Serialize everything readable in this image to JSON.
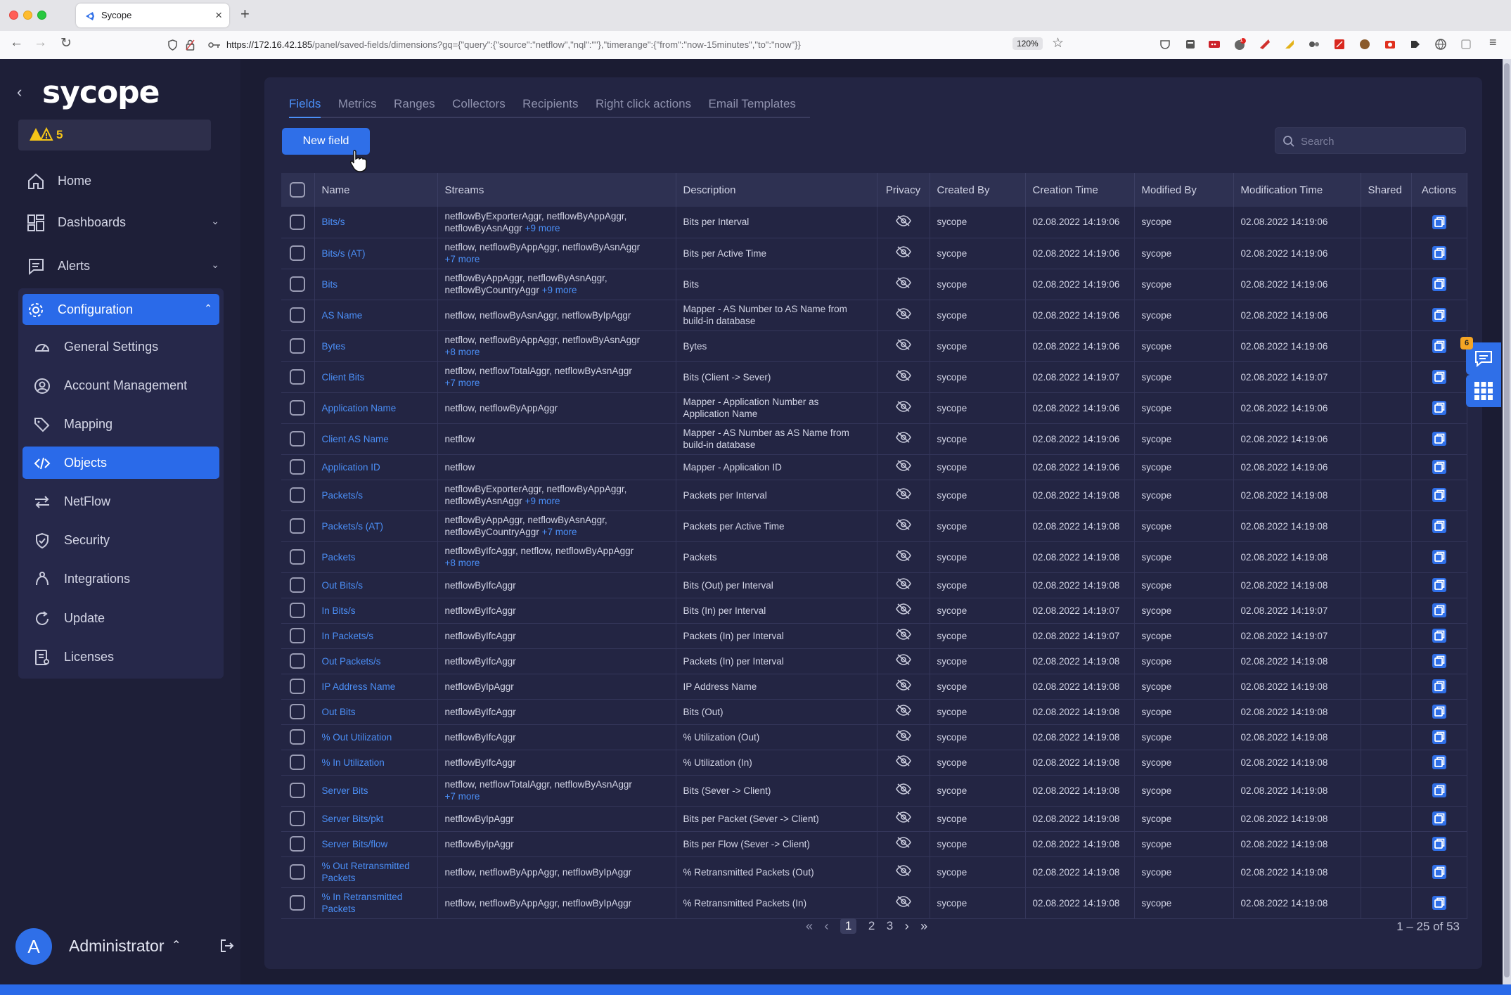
{
  "browser": {
    "tab_title": "Sycope",
    "url_host": "https://172.16.42.185",
    "url_path": "/panel/saved-fields/dimensions?gq={\"query\":{\"source\":\"netflow\",\"nql\":\"\"},\"timerange\":{\"from\":\"now-15minutes\",\"to\":\"now\"}}",
    "zoom": "120%",
    "ext_badge": "1"
  },
  "sidebar": {
    "logo": "sycope",
    "alert_count": "5",
    "nav": {
      "home": "Home",
      "dashboards": "Dashboards",
      "alerts": "Alerts",
      "configuration": "Configuration"
    },
    "sub": {
      "general": "General Settings",
      "account": "Account Management",
      "mapping": "Mapping",
      "objects": "Objects",
      "netflow": "NetFlow",
      "security": "Security",
      "integrations": "Integrations",
      "update": "Update",
      "licenses": "Licenses"
    },
    "user": {
      "initial": "A",
      "name": "Administrator"
    }
  },
  "main": {
    "tabs": [
      "Fields",
      "Metrics",
      "Ranges",
      "Collectors",
      "Recipients",
      "Right click actions",
      "Email Templates"
    ],
    "new_field_label": "New field",
    "search_placeholder": "Search",
    "columns": [
      "Name",
      "Streams",
      "Description",
      "Privacy",
      "Created By",
      "Creation Time",
      "Modified By",
      "Modification Time",
      "Shared",
      "Actions"
    ],
    "rows": [
      {
        "name": "Bits/s",
        "streams": "netflowByExporterAggr, netflowByAppAggr,",
        "streams2": "netflowByAsnAggr",
        "more": "+9 more",
        "desc": "Bits per Interval",
        "desc2": "",
        "created_by": "sycope",
        "created": "02.08.2022 14:19:06",
        "modified_by": "sycope",
        "modified": "02.08.2022 14:19:06"
      },
      {
        "name": "Bits/s (AT)",
        "streams": "netflow, netflowByAppAggr, netflowByAsnAggr",
        "streams2": "",
        "more": "+7 more",
        "desc": "Bits per Active Time",
        "desc2": "",
        "created_by": "sycope",
        "created": "02.08.2022 14:19:06",
        "modified_by": "sycope",
        "modified": "02.08.2022 14:19:06"
      },
      {
        "name": "Bits",
        "streams": "netflowByAppAggr, netflowByAsnAggr,",
        "streams2": "netflowByCountryAggr",
        "more": "+9 more",
        "desc": "Bits",
        "desc2": "",
        "created_by": "sycope",
        "created": "02.08.2022 14:19:06",
        "modified_by": "sycope",
        "modified": "02.08.2022 14:19:06"
      },
      {
        "name": "AS Name",
        "streams": "netflow, netflowByAsnAggr, netflowByIpAggr",
        "streams2": "",
        "more": "",
        "desc": "Mapper - AS Number to AS Name from",
        "desc2": "build-in database",
        "created_by": "sycope",
        "created": "02.08.2022 14:19:06",
        "modified_by": "sycope",
        "modified": "02.08.2022 14:19:06"
      },
      {
        "name": "Bytes",
        "streams": "netflow, netflowByAppAggr, netflowByAsnAggr",
        "streams2": "",
        "more": "+8 more",
        "desc": "Bytes",
        "desc2": "",
        "created_by": "sycope",
        "created": "02.08.2022 14:19:06",
        "modified_by": "sycope",
        "modified": "02.08.2022 14:19:06"
      },
      {
        "name": "Client Bits",
        "streams": "netflow, netflowTotalAggr, netflowByAsnAggr",
        "streams2": "",
        "more": "+7 more",
        "desc": "Bits (Client -> Sever)",
        "desc2": "",
        "created_by": "sycope",
        "created": "02.08.2022 14:19:07",
        "modified_by": "sycope",
        "modified": "02.08.2022 14:19:07"
      },
      {
        "name": "Application Name",
        "streams": "netflow, netflowByAppAggr",
        "streams2": "",
        "more": "",
        "desc": "Mapper - Application Number as",
        "desc2": "Application Name",
        "created_by": "sycope",
        "created": "02.08.2022 14:19:06",
        "modified_by": "sycope",
        "modified": "02.08.2022 14:19:06"
      },
      {
        "name": "Client AS Name",
        "streams": "netflow",
        "streams2": "",
        "more": "",
        "desc": "Mapper - AS Number as AS Name from",
        "desc2": "build-in database",
        "created_by": "sycope",
        "created": "02.08.2022 14:19:06",
        "modified_by": "sycope",
        "modified": "02.08.2022 14:19:06"
      },
      {
        "name": "Application ID",
        "streams": "netflow",
        "streams2": "",
        "more": "",
        "desc": "Mapper - Application ID",
        "desc2": "",
        "created_by": "sycope",
        "created": "02.08.2022 14:19:06",
        "modified_by": "sycope",
        "modified": "02.08.2022 14:19:06"
      },
      {
        "name": "Packets/s",
        "streams": "netflowByExporterAggr, netflowByAppAggr,",
        "streams2": "netflowByAsnAggr",
        "more": "+9 more",
        "desc": "Packets per Interval",
        "desc2": "",
        "created_by": "sycope",
        "created": "02.08.2022 14:19:08",
        "modified_by": "sycope",
        "modified": "02.08.2022 14:19:08"
      },
      {
        "name": "Packets/s (AT)",
        "streams": "netflowByAppAggr, netflowByAsnAggr,",
        "streams2": "netflowByCountryAggr",
        "more": "+7 more",
        "desc": "Packets per Active Time",
        "desc2": "",
        "created_by": "sycope",
        "created": "02.08.2022 14:19:08",
        "modified_by": "sycope",
        "modified": "02.08.2022 14:19:08"
      },
      {
        "name": "Packets",
        "streams": "netflowByIfcAggr, netflow, netflowByAppAggr",
        "streams2": "",
        "more": "+8 more",
        "desc": "Packets",
        "desc2": "",
        "created_by": "sycope",
        "created": "02.08.2022 14:19:08",
        "modified_by": "sycope",
        "modified": "02.08.2022 14:19:08"
      },
      {
        "name": "Out Bits/s",
        "streams": "netflowByIfcAggr",
        "streams2": "",
        "more": "",
        "desc": "Bits (Out) per Interval",
        "desc2": "",
        "created_by": "sycope",
        "created": "02.08.2022 14:19:08",
        "modified_by": "sycope",
        "modified": "02.08.2022 14:19:08"
      },
      {
        "name": "In Bits/s",
        "streams": "netflowByIfcAggr",
        "streams2": "",
        "more": "",
        "desc": "Bits (In) per Interval",
        "desc2": "",
        "created_by": "sycope",
        "created": "02.08.2022 14:19:07",
        "modified_by": "sycope",
        "modified": "02.08.2022 14:19:07"
      },
      {
        "name": "In Packets/s",
        "streams": "netflowByIfcAggr",
        "streams2": "",
        "more": "",
        "desc": "Packets (In) per Interval",
        "desc2": "",
        "created_by": "sycope",
        "created": "02.08.2022 14:19:07",
        "modified_by": "sycope",
        "modified": "02.08.2022 14:19:07"
      },
      {
        "name": "Out Packets/s",
        "streams": "netflowByIfcAggr",
        "streams2": "",
        "more": "",
        "desc": "Packets (In) per Interval",
        "desc2": "",
        "created_by": "sycope",
        "created": "02.08.2022 14:19:08",
        "modified_by": "sycope",
        "modified": "02.08.2022 14:19:08"
      },
      {
        "name": "IP Address Name",
        "streams": "netflowByIpAggr",
        "streams2": "",
        "more": "",
        "desc": "IP Address Name",
        "desc2": "",
        "created_by": "sycope",
        "created": "02.08.2022 14:19:08",
        "modified_by": "sycope",
        "modified": "02.08.2022 14:19:08"
      },
      {
        "name": "Out Bits",
        "streams": "netflowByIfcAggr",
        "streams2": "",
        "more": "",
        "desc": "Bits (Out)",
        "desc2": "",
        "created_by": "sycope",
        "created": "02.08.2022 14:19:08",
        "modified_by": "sycope",
        "modified": "02.08.2022 14:19:08"
      },
      {
        "name": "% Out Utilization",
        "streams": "netflowByIfcAggr",
        "streams2": "",
        "more": "",
        "desc": "% Utilization (Out)",
        "desc2": "",
        "created_by": "sycope",
        "created": "02.08.2022 14:19:08",
        "modified_by": "sycope",
        "modified": "02.08.2022 14:19:08"
      },
      {
        "name": "% In Utilization",
        "streams": "netflowByIfcAggr",
        "streams2": "",
        "more": "",
        "desc": "% Utilization (In)",
        "desc2": "",
        "created_by": "sycope",
        "created": "02.08.2022 14:19:08",
        "modified_by": "sycope",
        "modified": "02.08.2022 14:19:08"
      },
      {
        "name": "Server Bits",
        "streams": "netflow, netflowTotalAggr, netflowByAsnAggr",
        "streams2": "",
        "more": "+7 more",
        "desc": "Bits (Sever -> Client)",
        "desc2": "",
        "created_by": "sycope",
        "created": "02.08.2022 14:19:08",
        "modified_by": "sycope",
        "modified": "02.08.2022 14:19:08"
      },
      {
        "name": "Server Bits/pkt",
        "streams": "netflowByIpAggr",
        "streams2": "",
        "more": "",
        "desc": "Bits per Packet (Sever -> Client)",
        "desc2": "",
        "created_by": "sycope",
        "created": "02.08.2022 14:19:08",
        "modified_by": "sycope",
        "modified": "02.08.2022 14:19:08"
      },
      {
        "name": "Server Bits/flow",
        "streams": "netflowByIpAggr",
        "streams2": "",
        "more": "",
        "desc": "Bits per Flow (Sever -> Client)",
        "desc2": "",
        "created_by": "sycope",
        "created": "02.08.2022 14:19:08",
        "modified_by": "sycope",
        "modified": "02.08.2022 14:19:08"
      },
      {
        "name": "% Out Retransmitted Packets",
        "streams": "netflow, netflowByAppAggr, netflowByIpAggr",
        "streams2": "",
        "more": "",
        "desc": "% Retransmitted Packets (Out)",
        "desc2": "",
        "created_by": "sycope",
        "created": "02.08.2022 14:19:08",
        "modified_by": "sycope",
        "modified": "02.08.2022 14:19:08"
      },
      {
        "name": "% In Retransmitted Packets",
        "streams": "netflow, netflowByAppAggr, netflowByIpAggr",
        "streams2": "",
        "more": "",
        "desc": "% Retransmitted Packets (In)",
        "desc2": "",
        "created_by": "sycope",
        "created": "02.08.2022 14:19:08",
        "modified_by": "sycope",
        "modified": "02.08.2022 14:19:08"
      }
    ],
    "pagination": {
      "pages": [
        "1",
        "2",
        "3"
      ],
      "current": "1",
      "summary": "1 – 25 of 53"
    },
    "widget_badge": "6"
  }
}
